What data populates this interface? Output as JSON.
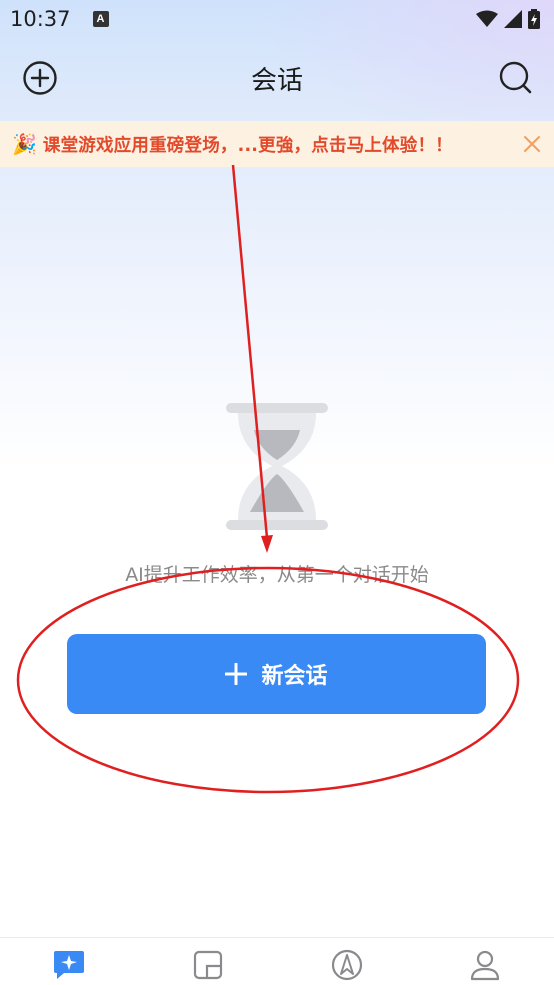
{
  "status_bar": {
    "time": "10:37",
    "notification_icon": "A",
    "icons": [
      "wifi-icon",
      "signal-icon",
      "battery-icon"
    ]
  },
  "header": {
    "title": "会话",
    "left_icon": "add-circle-icon",
    "right_icon": "search-icon"
  },
  "banner": {
    "emoji": "🎉",
    "text": "课堂游戏应用重磅登场，...更強，点击马上体验！！",
    "close_icon": "close-icon"
  },
  "empty_state": {
    "icon": "hourglass-icon",
    "message": "AI提升工作效率，从第一个对话开始"
  },
  "new_chat_button": {
    "label": "新会话",
    "icon": "plus-icon"
  },
  "bottom_nav": {
    "items": [
      {
        "icon": "chat-sparkle-icon",
        "active": true
      },
      {
        "icon": "notes-icon",
        "active": false
      },
      {
        "icon": "compass-icon",
        "active": false
      },
      {
        "icon": "profile-icon",
        "active": false
      }
    ]
  },
  "colors": {
    "accent": "#3a8af5",
    "banner_text": "#e24a2b",
    "banner_bg": "#fdf1e2",
    "annotation": "#e02020"
  }
}
